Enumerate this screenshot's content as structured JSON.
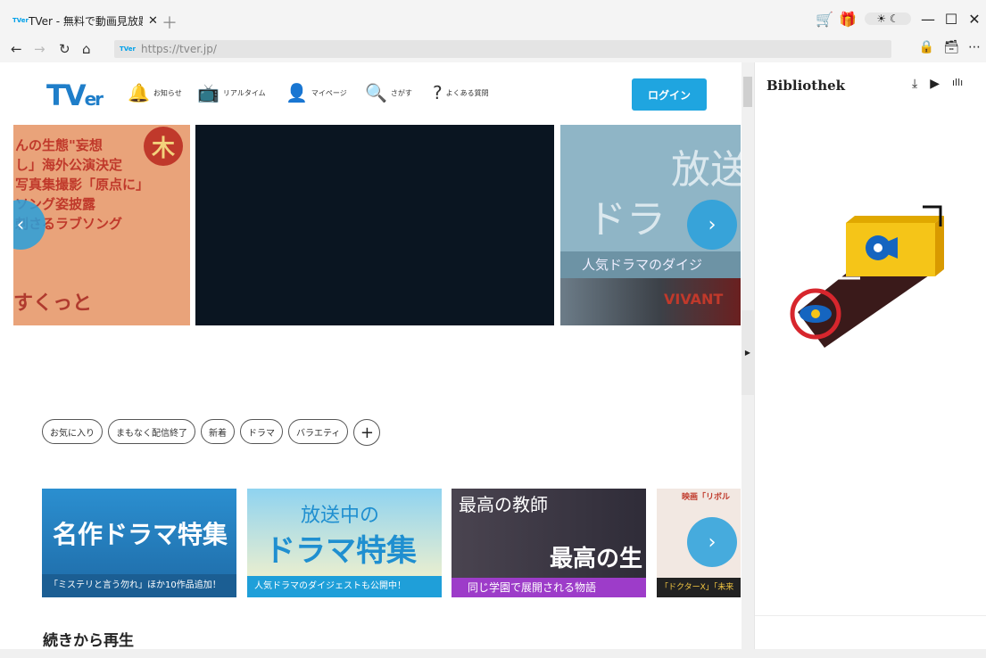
{
  "browser": {
    "tab_title": "TVer - 無料で動画見放題",
    "tab_favicon": "TVer",
    "url": "https://tver.jp/",
    "colors": {
      "cart": "#e53935",
      "gift": "#e6a11f"
    }
  },
  "site": {
    "logo_main": "TV",
    "logo_sub": "er",
    "nav": [
      {
        "icon": "bell-icon",
        "label": "お知らせ"
      },
      {
        "icon": "tv-icon",
        "label": "リアルタイム"
      },
      {
        "icon": "user-icon",
        "label": "マイページ"
      },
      {
        "icon": "search-icon",
        "label": "さがす"
      },
      {
        "icon": "help-icon",
        "label": "よくある質問"
      }
    ],
    "login_label": "ログイン",
    "hero_left_text": "んの生態\"妄想\nし」海外公演決定\n写真集撮影「原点に」\nソング姿披露\n刺さるラブソング",
    "hero_left_badge": "木",
    "hero_left_bottom": "すくっと",
    "hero_right_big1": "放送",
    "hero_right_big2": "ドラ",
    "hero_right_band": "人気ドラマのダイジ",
    "hero_right_vivant": "VIVANT",
    "chips": [
      "お気に入り",
      "まもなく配信終了",
      "新着",
      "ドラマ",
      "バラエティ"
    ],
    "cards": [
      {
        "title": "名作ドラマ特集",
        "sub": "「ミステリと言う勿れ」ほか10作品追加！"
      },
      {
        "title1": "放送中の",
        "title2": "ドラマ特集",
        "sub": "人気ドラマのダイジェストも公開中！"
      },
      {
        "title1": "最高の教師",
        "title2": "最高の生徒",
        "sub": "同じ学園で展開される物語"
      },
      {
        "title1": "映画「リボル",
        "sub": "「ドクターX」「未来"
      }
    ],
    "section_title": "続きから再生"
  },
  "panel": {
    "title": "Bibliothek",
    "colors": {
      "accent": "#f5c518",
      "dark": "#3a1a1a",
      "red": "#d7262d",
      "blue": "#1565c0"
    }
  }
}
